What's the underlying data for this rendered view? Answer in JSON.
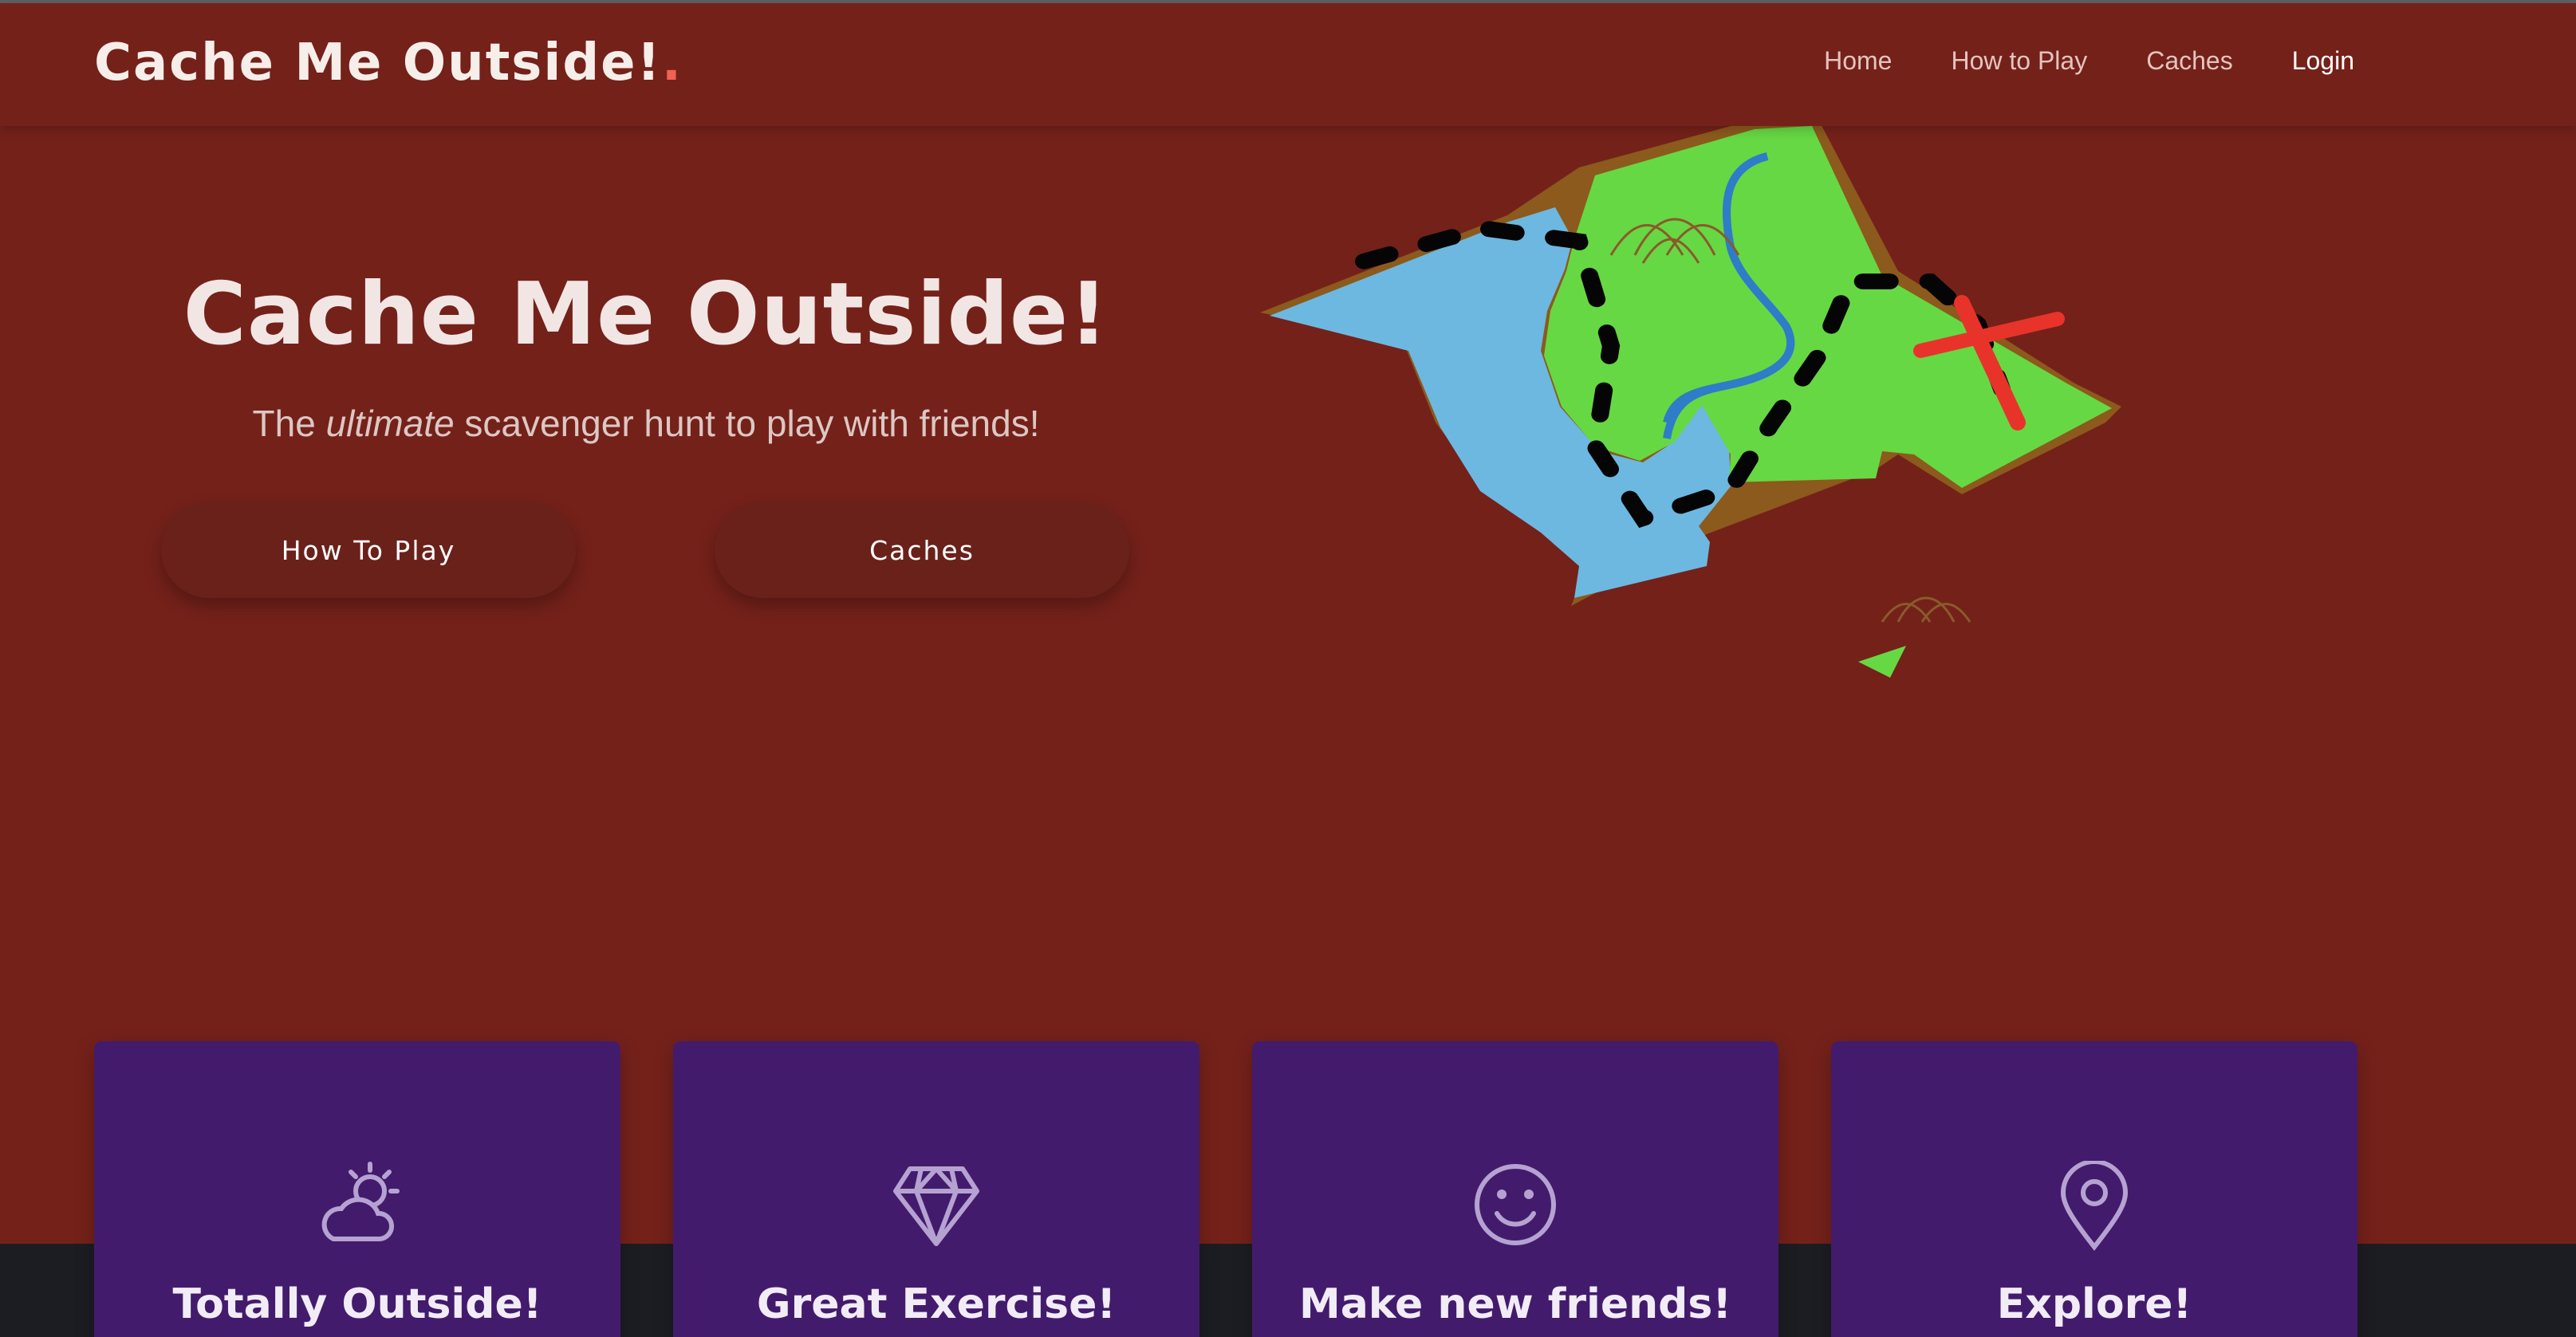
{
  "brand": {
    "name": "Cache Me Outside!",
    "dot": "."
  },
  "nav": {
    "items": [
      {
        "label": "Home"
      },
      {
        "label": "How to Play"
      },
      {
        "label": "Caches"
      },
      {
        "label": "Login"
      }
    ]
  },
  "hero": {
    "title": "Cache Me Outside!",
    "subtitle_before": "The ",
    "subtitle_em": "ultimate",
    "subtitle_after": " scavenger hunt to play with friends!",
    "buttons": {
      "how_to_play": "How To Play",
      "caches": "Caches"
    }
  },
  "features": [
    {
      "title": "Totally Outside!",
      "icon": "partly-cloudy-icon"
    },
    {
      "title": "Great Exercise!",
      "icon": "diamond-icon"
    },
    {
      "title": "Make new friends!",
      "icon": "smiley-icon"
    },
    {
      "title": "Explore!",
      "icon": "map-pin-icon"
    }
  ],
  "colors": {
    "background": "#74211a",
    "button": "#6a211a",
    "card": "#431b6d",
    "footer": "#1c1d22",
    "accent_dot": "#f06254",
    "map_water": "#6cb8e0",
    "map_land": "#66d843",
    "map_x": "#e8332a"
  }
}
